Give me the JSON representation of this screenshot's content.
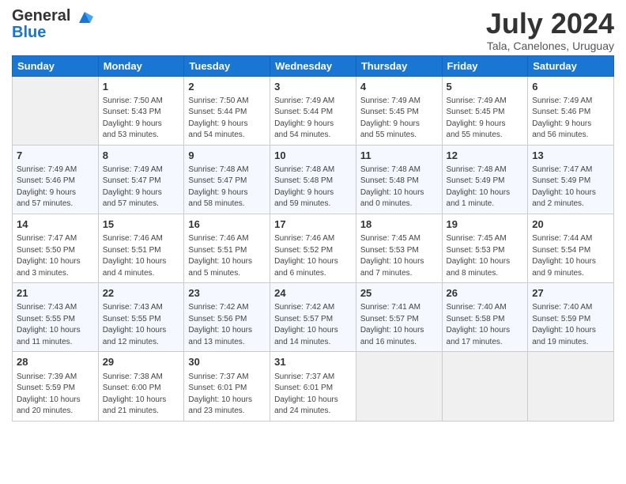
{
  "header": {
    "logo_line1": "General",
    "logo_line2": "Blue",
    "month_year": "July 2024",
    "location": "Tala, Canelones, Uruguay"
  },
  "days_of_week": [
    "Sunday",
    "Monday",
    "Tuesday",
    "Wednesday",
    "Thursday",
    "Friday",
    "Saturday"
  ],
  "weeks": [
    [
      {
        "day": "",
        "info": ""
      },
      {
        "day": "1",
        "info": "Sunrise: 7:50 AM\nSunset: 5:43 PM\nDaylight: 9 hours\nand 53 minutes."
      },
      {
        "day": "2",
        "info": "Sunrise: 7:50 AM\nSunset: 5:44 PM\nDaylight: 9 hours\nand 54 minutes."
      },
      {
        "day": "3",
        "info": "Sunrise: 7:49 AM\nSunset: 5:44 PM\nDaylight: 9 hours\nand 54 minutes."
      },
      {
        "day": "4",
        "info": "Sunrise: 7:49 AM\nSunset: 5:45 PM\nDaylight: 9 hours\nand 55 minutes."
      },
      {
        "day": "5",
        "info": "Sunrise: 7:49 AM\nSunset: 5:45 PM\nDaylight: 9 hours\nand 55 minutes."
      },
      {
        "day": "6",
        "info": "Sunrise: 7:49 AM\nSunset: 5:46 PM\nDaylight: 9 hours\nand 56 minutes."
      }
    ],
    [
      {
        "day": "7",
        "info": "Sunrise: 7:49 AM\nSunset: 5:46 PM\nDaylight: 9 hours\nand 57 minutes."
      },
      {
        "day": "8",
        "info": "Sunrise: 7:49 AM\nSunset: 5:47 PM\nDaylight: 9 hours\nand 57 minutes."
      },
      {
        "day": "9",
        "info": "Sunrise: 7:48 AM\nSunset: 5:47 PM\nDaylight: 9 hours\nand 58 minutes."
      },
      {
        "day": "10",
        "info": "Sunrise: 7:48 AM\nSunset: 5:48 PM\nDaylight: 9 hours\nand 59 minutes."
      },
      {
        "day": "11",
        "info": "Sunrise: 7:48 AM\nSunset: 5:48 PM\nDaylight: 10 hours\nand 0 minutes."
      },
      {
        "day": "12",
        "info": "Sunrise: 7:48 AM\nSunset: 5:49 PM\nDaylight: 10 hours\nand 1 minute."
      },
      {
        "day": "13",
        "info": "Sunrise: 7:47 AM\nSunset: 5:49 PM\nDaylight: 10 hours\nand 2 minutes."
      }
    ],
    [
      {
        "day": "14",
        "info": "Sunrise: 7:47 AM\nSunset: 5:50 PM\nDaylight: 10 hours\nand 3 minutes."
      },
      {
        "day": "15",
        "info": "Sunrise: 7:46 AM\nSunset: 5:51 PM\nDaylight: 10 hours\nand 4 minutes."
      },
      {
        "day": "16",
        "info": "Sunrise: 7:46 AM\nSunset: 5:51 PM\nDaylight: 10 hours\nand 5 minutes."
      },
      {
        "day": "17",
        "info": "Sunrise: 7:46 AM\nSunset: 5:52 PM\nDaylight: 10 hours\nand 6 minutes."
      },
      {
        "day": "18",
        "info": "Sunrise: 7:45 AM\nSunset: 5:53 PM\nDaylight: 10 hours\nand 7 minutes."
      },
      {
        "day": "19",
        "info": "Sunrise: 7:45 AM\nSunset: 5:53 PM\nDaylight: 10 hours\nand 8 minutes."
      },
      {
        "day": "20",
        "info": "Sunrise: 7:44 AM\nSunset: 5:54 PM\nDaylight: 10 hours\nand 9 minutes."
      }
    ],
    [
      {
        "day": "21",
        "info": "Sunrise: 7:43 AM\nSunset: 5:55 PM\nDaylight: 10 hours\nand 11 minutes."
      },
      {
        "day": "22",
        "info": "Sunrise: 7:43 AM\nSunset: 5:55 PM\nDaylight: 10 hours\nand 12 minutes."
      },
      {
        "day": "23",
        "info": "Sunrise: 7:42 AM\nSunset: 5:56 PM\nDaylight: 10 hours\nand 13 minutes."
      },
      {
        "day": "24",
        "info": "Sunrise: 7:42 AM\nSunset: 5:57 PM\nDaylight: 10 hours\nand 14 minutes."
      },
      {
        "day": "25",
        "info": "Sunrise: 7:41 AM\nSunset: 5:57 PM\nDaylight: 10 hours\nand 16 minutes."
      },
      {
        "day": "26",
        "info": "Sunrise: 7:40 AM\nSunset: 5:58 PM\nDaylight: 10 hours\nand 17 minutes."
      },
      {
        "day": "27",
        "info": "Sunrise: 7:40 AM\nSunset: 5:59 PM\nDaylight: 10 hours\nand 19 minutes."
      }
    ],
    [
      {
        "day": "28",
        "info": "Sunrise: 7:39 AM\nSunset: 5:59 PM\nDaylight: 10 hours\nand 20 minutes."
      },
      {
        "day": "29",
        "info": "Sunrise: 7:38 AM\nSunset: 6:00 PM\nDaylight: 10 hours\nand 21 minutes."
      },
      {
        "day": "30",
        "info": "Sunrise: 7:37 AM\nSunset: 6:01 PM\nDaylight: 10 hours\nand 23 minutes."
      },
      {
        "day": "31",
        "info": "Sunrise: 7:37 AM\nSunset: 6:01 PM\nDaylight: 10 hours\nand 24 minutes."
      },
      {
        "day": "",
        "info": ""
      },
      {
        "day": "",
        "info": ""
      },
      {
        "day": "",
        "info": ""
      }
    ]
  ]
}
